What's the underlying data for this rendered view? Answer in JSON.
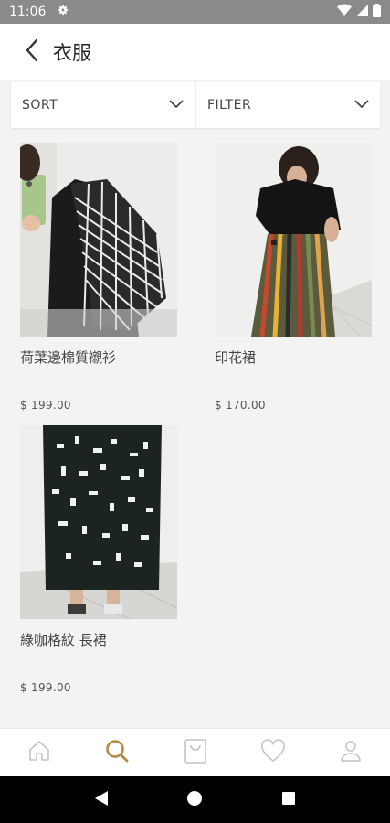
{
  "status_bar": {
    "time": "11:06"
  },
  "header": {
    "title": "衣服"
  },
  "controls": {
    "sort_label": "SORT",
    "filter_label": "FILTER"
  },
  "products": [
    {
      "name": "荷葉邊棉質襯衫",
      "price": "$ 199.00"
    },
    {
      "name": "印花裙",
      "price": "$ 170.00"
    },
    {
      "name": "綠咖格紋 長裙",
      "price": "$ 199.00"
    }
  ],
  "bottom_nav": {
    "items": [
      "home-icon",
      "search-icon",
      "bag-icon",
      "heart-icon",
      "profile-icon"
    ],
    "active": "search-icon"
  },
  "colors": {
    "accent": "#b58a45",
    "icon": "#c4c4c4",
    "status_bar": "#8a8a8a"
  }
}
